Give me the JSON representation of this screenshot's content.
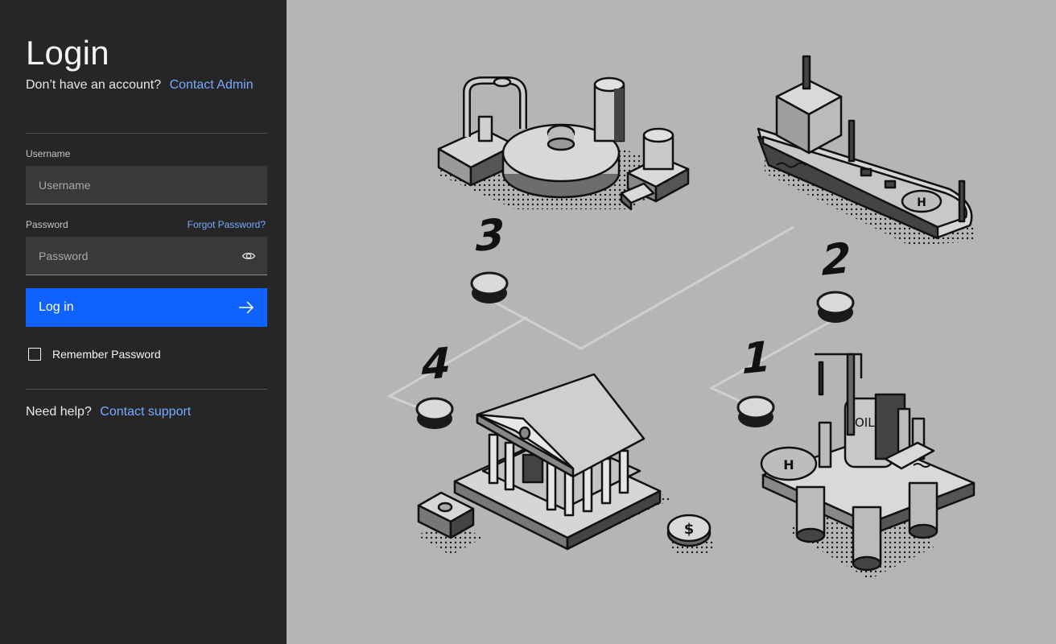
{
  "login": {
    "title": "Login",
    "signup_prompt": "Don’t have an account?",
    "signup_link": "Contact Admin",
    "username_label": "Username",
    "username_placeholder": "Username",
    "password_label": "Password",
    "forgot_link": "Forgot Password?",
    "password_placeholder": "Password",
    "submit_label": "Log in",
    "remember_label": "Remember Password",
    "remember_checked": false,
    "help_prompt": "Need help?",
    "help_link": "Contact support"
  },
  "illustration": {
    "steps": [
      "1",
      "2",
      "3",
      "4"
    ],
    "rig_label": "OIL",
    "coin_symbol": "$",
    "helipad_mark": "H"
  },
  "colors": {
    "panel": "#262626",
    "accent": "#0f62fe",
    "link": "#78a9ff",
    "field": "#393939",
    "background": "#b5b5b5"
  },
  "icons": [
    "eye-icon",
    "arrow-right-icon",
    "checkbox-icon"
  ]
}
